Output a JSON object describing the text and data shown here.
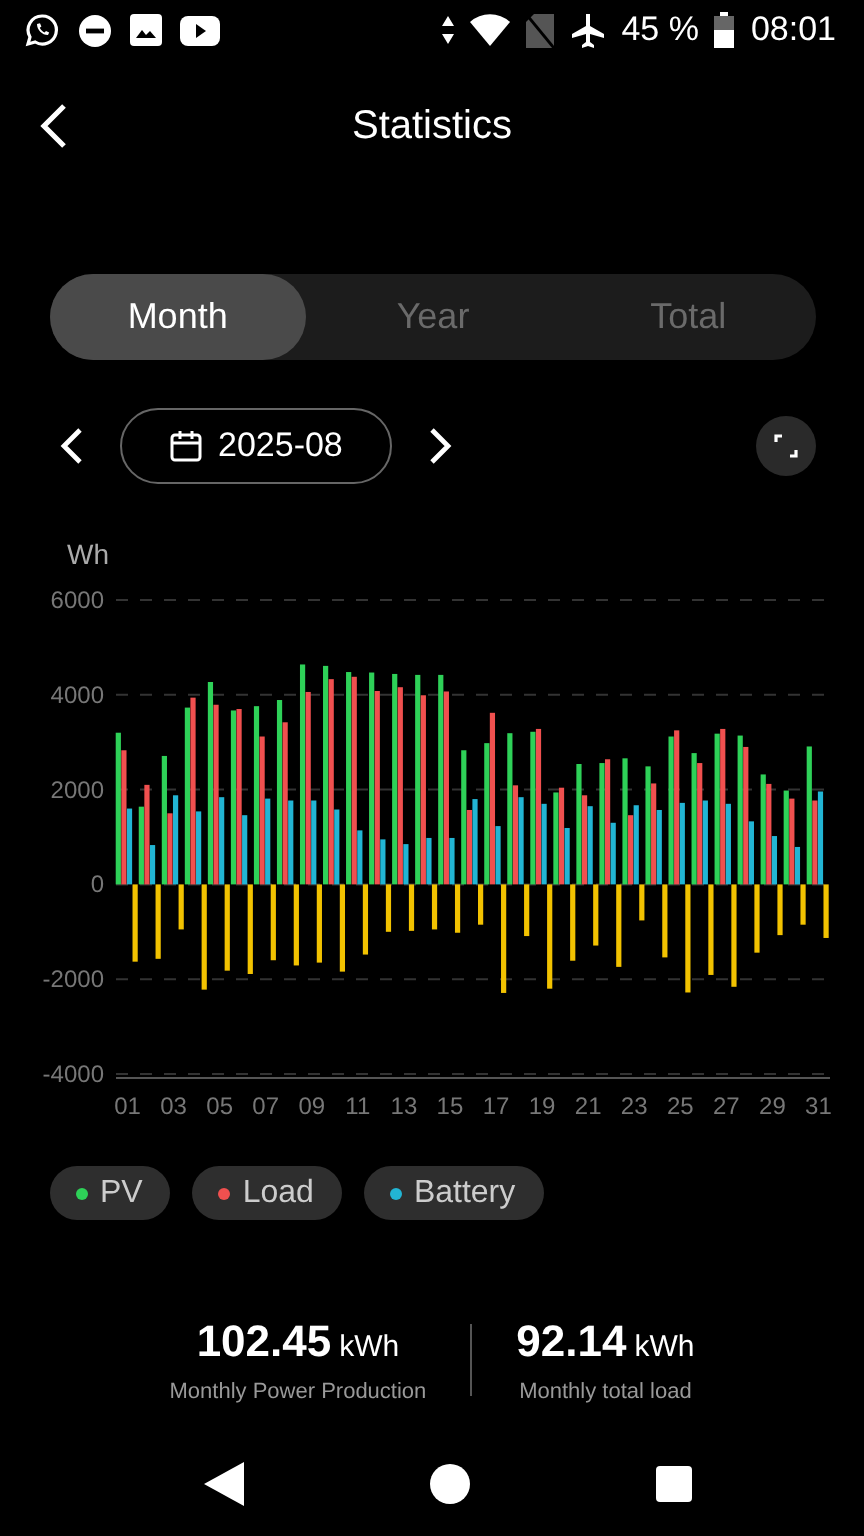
{
  "status_bar": {
    "battery": "45 %",
    "time": "08:01"
  },
  "header": {
    "title": "Statistics"
  },
  "tabs": [
    {
      "label": "Month",
      "selected": true
    },
    {
      "label": "Year",
      "selected": false
    },
    {
      "label": "Total",
      "selected": false
    }
  ],
  "date_picker": {
    "value": "2025-08"
  },
  "chart_data": {
    "type": "bar",
    "ylabel": "Wh",
    "x": [
      1,
      2,
      3,
      4,
      5,
      6,
      7,
      8,
      9,
      10,
      11,
      12,
      13,
      14,
      15,
      16,
      17,
      18,
      19,
      20,
      21,
      22,
      23,
      24,
      25,
      26,
      27,
      28,
      29,
      30,
      31
    ],
    "xticks": [
      {
        "value": 1,
        "label": "01"
      },
      {
        "value": 3,
        "label": "03"
      },
      {
        "value": 5,
        "label": "05"
      },
      {
        "value": 7,
        "label": "07"
      },
      {
        "value": 9,
        "label": "09"
      },
      {
        "value": 11,
        "label": "11"
      },
      {
        "value": 13,
        "label": "13"
      },
      {
        "value": 15,
        "label": "15"
      },
      {
        "value": 17,
        "label": "17"
      },
      {
        "value": 19,
        "label": "19"
      },
      {
        "value": 21,
        "label": "21"
      },
      {
        "value": 23,
        "label": "23"
      },
      {
        "value": 25,
        "label": "25"
      },
      {
        "value": 27,
        "label": "27"
      },
      {
        "value": 29,
        "label": "29"
      },
      {
        "value": 31,
        "label": "31"
      }
    ],
    "xlim": [
      0.5,
      31.5
    ],
    "grid": true,
    "stacked": false,
    "ylim": [
      -4000,
      6000
    ],
    "yticks": [
      -4000,
      -2000,
      0,
      2000,
      4000,
      6000
    ],
    "series": [
      {
        "name": "PV",
        "color": "#2ed158",
        "values": [
          3200,
          1640,
          2710,
          3730,
          4270,
          3670,
          3760,
          3890,
          4640,
          4610,
          4480,
          4470,
          4440,
          4420,
          4420,
          2830,
          2980,
          3190,
          3220,
          1940,
          2540,
          2560,
          2660,
          2490,
          3120,
          2770,
          3180,
          3140,
          2320,
          1980,
          2910
        ]
      },
      {
        "name": "Load",
        "color": "#f0504f",
        "values": [
          2830,
          2100,
          1500,
          3940,
          3790,
          3700,
          3120,
          3420,
          4060,
          4330,
          4380,
          4080,
          4160,
          3990,
          4070,
          1570,
          3620,
          2090,
          3280,
          2040,
          1880,
          2640,
          1460,
          2130,
          3250,
          2560,
          3280,
          2900,
          2120,
          1810,
          1770
        ]
      },
      {
        "name": "Battery",
        "color": "#22b5d4",
        "values": [
          1600,
          830,
          1880,
          1540,
          1840,
          1460,
          1810,
          1770,
          1770,
          1580,
          1140,
          950,
          850,
          980,
          980,
          1800,
          1230,
          1840,
          1700,
          1190,
          1650,
          1300,
          1670,
          1570,
          1720,
          1770,
          1700,
          1330,
          1020,
          790,
          1960
        ]
      },
      {
        "color": "#f2c200",
        "values": [
          -1630,
          -1570,
          -950,
          -2220,
          -1820,
          -1890,
          -1600,
          -1710,
          -1650,
          -1840,
          -1480,
          -1000,
          -980,
          -950,
          -1020,
          -850,
          -2290,
          -1090,
          -2200,
          -1610,
          -1290,
          -1740,
          -760,
          -1540,
          -2280,
          -1910,
          -2160,
          -1440,
          -1070,
          -850,
          -1130
        ]
      }
    ]
  },
  "summary": [
    {
      "value": "102.45",
      "unit": "kWh",
      "label": "Monthly Power Production"
    },
    {
      "value": "92.14",
      "unit": "kWh",
      "label": "Monthly total load"
    }
  ]
}
